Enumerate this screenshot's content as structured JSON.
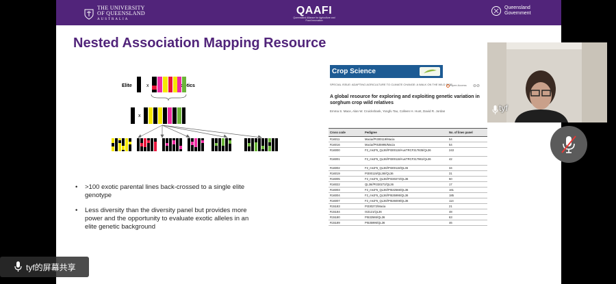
{
  "slide": {
    "banner": {
      "uq_line1": "THE UNIVERSITY",
      "uq_line2": "OF QUEENSLAND",
      "uq_line3": "AUSTRALIA",
      "qaafi": "QAAFI",
      "qaafi_sub": "Queensland Alliance for Agriculture and Food Innovation",
      "qld_line1": "Queensland",
      "qld_line2": "Government"
    },
    "title": "Nested Association Mapping Resource",
    "diagram": {
      "elite_label": "Elite",
      "exotics_label": "Exotics",
      "cross_symbol": "x"
    },
    "bullets": [
      ">100 exotic parental lines back-crossed to a single elite genotype",
      "Less diversity than the diversity panel but provides more power and the opportunity to evaluate exotic alleles in an elite genetic background"
    ],
    "paper": {
      "journal": "Crop Science",
      "special_issue": "SPECIAL ISSUE: ADAPTING AGRICULTURE TO CLIMATE CHANGE: A WALK ON THE WILD SIDE",
      "open_access": "Open Access",
      "title": "A global resource for exploring and exploiting genetic variation in sorghum crop wild relatives",
      "authors": "Emma S. Mace, Alan W. Cruickshank, Yongfu Tao, Colleen H. Hunt, David R. Jordan",
      "table": {
        "headers": [
          "Cross code",
          "Pedigree",
          "No. of lines panel"
        ],
        "rows": [
          [
            "R16011",
            "Macia//PI300119/Macia",
            "54"
          ],
          [
            "R16016",
            "Macia//PI535995/Macia",
            "54"
          ],
          [
            "R16000",
            "F2_ms3*5_QL36//PI300119/AusTRCF317835/QL36",
            "243"
          ],
          [
            "R16001",
            "F2_ms3*5_QL36//PI300119/AusTRCF317961/QL36",
            "42"
          ],
          [
            "R16002",
            "F2_ms3*5_QL36//PI300119/QL36",
            "34"
          ],
          [
            "R16019",
            "PI300119/QL36//QL36",
            "31"
          ],
          [
            "R16005",
            "F2_ms3*5_QL36//PI330272/QL36",
            "50"
          ],
          [
            "R16022",
            "QL36//PI330272/QL36",
            "17"
          ],
          [
            "R16003",
            "F2_ms3*5_QL36//PI532566/QL36",
            "161"
          ],
          [
            "R16004",
            "F2_ms3*5_QL36//PI535995/QL36",
            "185"
          ],
          [
            "R16007",
            "F2_ms3*5_QL36//PI536008/QL36",
            "114"
          ],
          [
            "R15183",
            "PI330272/Macia",
            "21"
          ],
          [
            "R15184",
            "IS3121/QL36",
            "48"
          ],
          [
            "R15180",
            "PI532565/QL36",
            "63"
          ],
          [
            "R15189",
            "PI535995/QL36",
            "46"
          ]
        ]
      }
    }
  },
  "participant": {
    "name": "tyf"
  },
  "share_label": "tyf的屏幕共享"
}
